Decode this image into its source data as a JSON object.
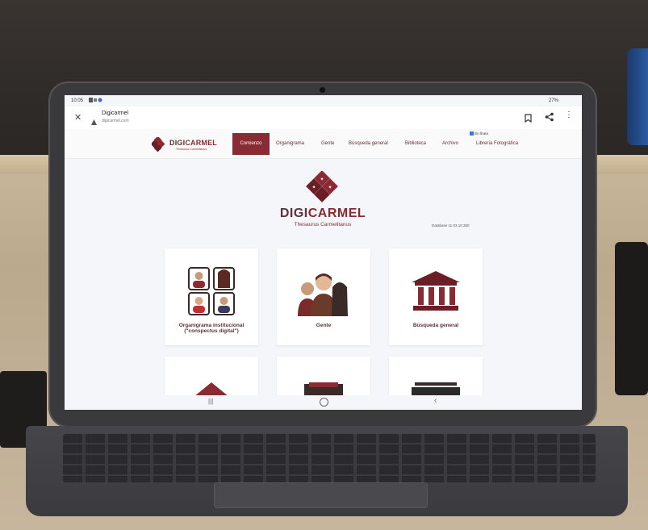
{
  "status_bar": {
    "time": "10:05",
    "battery": "27%"
  },
  "browser": {
    "page_title": "Digicarmel",
    "url": "digicarmel.com"
  },
  "site_nav": {
    "brand_prefix": "DIGI",
    "brand_suffix": "CARMEL",
    "brand_tagline": "Thesaurus Carmelitanus",
    "items": [
      "Comienzo",
      "Organigrama",
      "Gente",
      "Búsqueda general",
      "Biblioteca",
      "Archivo",
      "Librería Fotográfica"
    ],
    "active_index": 0,
    "archive_badge": "En línea"
  },
  "hero": {
    "brand_prefix": "DIGI",
    "brand_suffix": "CARMEL",
    "tagline": "Thesaurus Carmelitanus",
    "database_note": "Database 11.03.10.350"
  },
  "cards": [
    {
      "label_line1": "Organigrama institucional",
      "label_line2": "(\"conspectus digital\")",
      "icon": "people-grid-icon"
    },
    {
      "label_line1": "Gente",
      "label_line2": "",
      "icon": "group-people-icon"
    },
    {
      "label_line1": "Búsqueda general",
      "label_line2": "",
      "icon": "building-columns-icon"
    }
  ],
  "colors": {
    "brand": "#8a2a32",
    "nav_active": "#8a2a32",
    "screen_bg": "#f4f6fa"
  }
}
